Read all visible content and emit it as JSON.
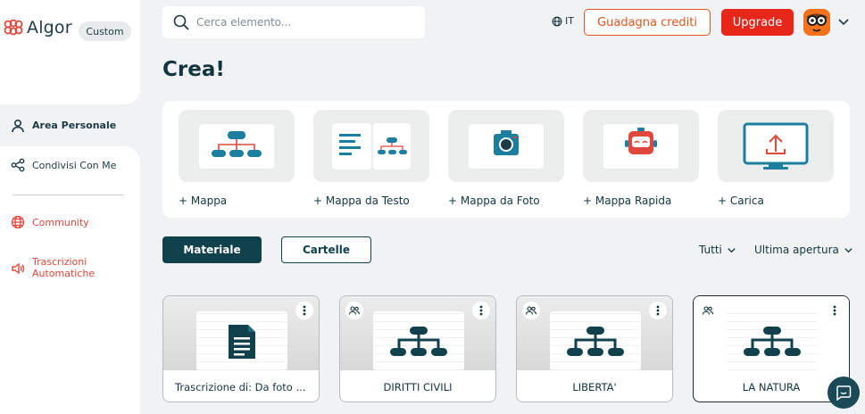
{
  "app": {
    "name": "Algor",
    "plan": "Custom"
  },
  "sidebar": {
    "items": [
      {
        "label": "Area Personale",
        "icon": "user-icon"
      },
      {
        "label": "Condivisi Con Me",
        "icon": "share-icon"
      },
      {
        "label": "Community",
        "icon": "globe-icon"
      },
      {
        "label": "Trascrizioni Automatiche",
        "icon": "speaker-icon"
      }
    ]
  },
  "header": {
    "search_placeholder": "Cerca elemento...",
    "language": "IT",
    "credits_label": "Guadagna crediti",
    "upgrade_label": "Upgrade"
  },
  "main": {
    "title": "Crea!",
    "create_options": [
      {
        "label": "+ Mappa",
        "icon": "mindmap-icon"
      },
      {
        "label": "+ Mappa da Testo",
        "icon": "text-map-icon"
      },
      {
        "label": "+ Mappa da Foto",
        "icon": "camera-icon"
      },
      {
        "label": "+ Mappa Rapida",
        "icon": "robot-icon"
      },
      {
        "label": "+ Carica",
        "icon": "upload-monitor-icon"
      }
    ],
    "tabs": [
      {
        "label": "Materiale"
      },
      {
        "label": "Cartelle"
      }
    ],
    "filters": {
      "type": "Tutti",
      "sort": "Ultima apertura"
    },
    "cards": [
      {
        "title": "Trascrizione di: Da foto ...",
        "icon": "document-icon",
        "shared": false
      },
      {
        "title": "DIRITTI CIVILI",
        "icon": "mindmap-icon",
        "shared": true
      },
      {
        "title": "LIBERTA'",
        "icon": "mindmap-icon",
        "shared": true
      },
      {
        "title": "LA NATURA",
        "icon": "mindmap-icon",
        "shared": true
      }
    ]
  },
  "colors": {
    "accent": "#12414e",
    "brand_red": "#e8271b",
    "credits_orange": "#e1541f"
  }
}
